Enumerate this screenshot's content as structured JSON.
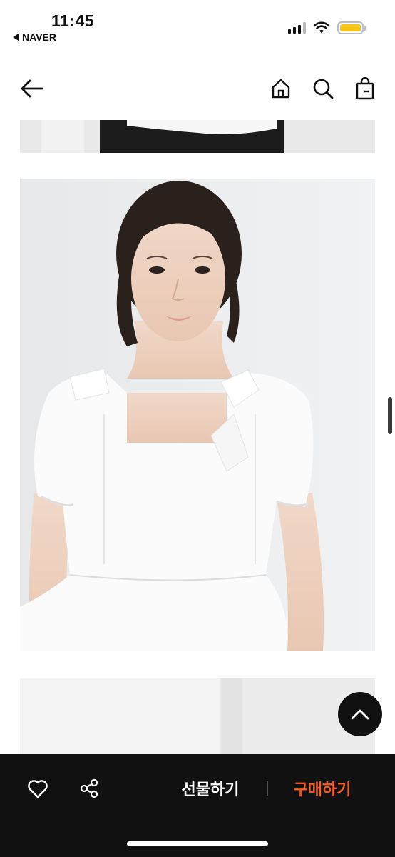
{
  "status_bar": {
    "time": "11:45",
    "back_app": "NAVER",
    "battery_color": "#f5c518"
  },
  "nav": {
    "icons": [
      "back-arrow-icon",
      "home-icon",
      "search-icon",
      "shopping-bag-icon"
    ]
  },
  "product_images": {
    "description_top": "cropped product photo",
    "description_main": "model wearing white square-neck puff sleeve blouse",
    "description_bottom": "cropped product photo"
  },
  "bottom_bar": {
    "wishlist_icon": "heart-icon",
    "share_icon": "share-icon",
    "gift_label": "선물하기",
    "buy_label": "구매하기",
    "buy_color": "#ff5a1f"
  }
}
